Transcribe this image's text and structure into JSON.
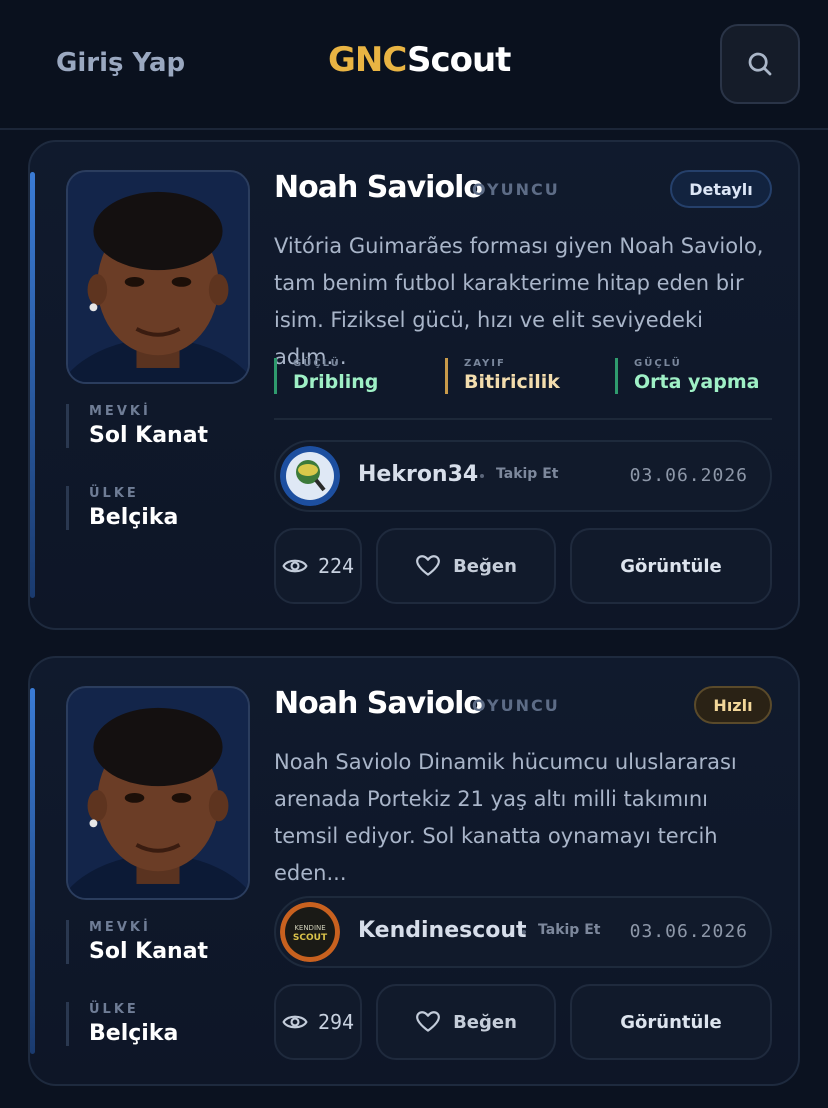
{
  "header": {
    "login_label": "Giriş Yap",
    "logo_part1": "GNC",
    "logo_part2": "Scout",
    "search_icon": "search-icon"
  },
  "colors": {
    "background": "#0b1220",
    "accent_gold": "#e9b443",
    "strong_tag": "#2f9b6e",
    "weak_tag": "#c89a4a"
  },
  "cards": [
    {
      "name": "Noah Saviolo",
      "role": "OYUNCU",
      "badge": "Detaylı",
      "position_label": "MEVKİ",
      "position_value": "Sol Kanat",
      "country_label": "ÜLKE",
      "country_value": "Belçika",
      "description": "Vitória Guimarães forması giyen Noah Saviolo, tam benim futbol karakterime hitap eden bir isim. Fiziksel gücü, hızı ve elit seviyedeki adım...",
      "tags": [
        {
          "kind": "GÜÇLÜ",
          "value": "Dribling"
        },
        {
          "kind": "ZAYIF",
          "value": "Bitiricilik"
        },
        {
          "kind": "GÜÇLÜ",
          "value": "Orta yapma"
        }
      ],
      "author": "Hekron34",
      "follow_label": "Takip Et",
      "date": "03.06.2026",
      "views": "224",
      "like_label": "Beğen",
      "view_label": "Görüntüle"
    },
    {
      "name": "Noah Saviolo",
      "role": "OYUNCU",
      "badge": "Hızlı",
      "position_label": "MEVKİ",
      "position_value": "Sol Kanat",
      "country_label": "ÜLKE",
      "country_value": "Belçika",
      "description": "Noah Saviolo Dinamik hücumcu uluslararası arenada Portekiz 21 yaş altı milli takımını temsil ediyor. Sol kanatta oynamayı tercih eden...",
      "author": "Kendinescout",
      "avatar_text_top": "KENDINE",
      "avatar_text_bottom": "SCOUT",
      "follow_label": "Takip Et",
      "date": "03.06.2026",
      "views": "294",
      "like_label": "Beğen",
      "view_label": "Görüntüle"
    }
  ]
}
